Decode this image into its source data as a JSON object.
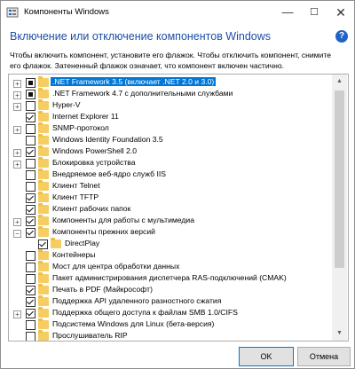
{
  "window": {
    "title": "Компоненты Windows",
    "controls": {
      "minimize": "—",
      "maximize": "☐",
      "close": "✕"
    }
  },
  "heading": "Включение или отключение компонентов Windows",
  "help_icon": "?",
  "description": [
    "Чтобы включить компонент, установите его флажок. Чтобы отключить компонент, снимите",
    "его флажок. Затененный флажок означает, что компонент включен частично."
  ],
  "features": [
    {
      "label": ".NET Framework 3.5 (включает .NET 2.0 и 3.0)",
      "state": "partial",
      "expandable": true,
      "selected": true,
      "level": 0
    },
    {
      "label": ".NET Framework 4.7 с дополнительными службами",
      "state": "partial",
      "expandable": true,
      "selected": false,
      "level": 0
    },
    {
      "label": "Hyper-V",
      "state": "unchecked",
      "expandable": true,
      "selected": false,
      "level": 0
    },
    {
      "label": "Internet Explorer 11",
      "state": "checked",
      "expandable": false,
      "selected": false,
      "level": 0
    },
    {
      "label": "SNMP-протокол",
      "state": "unchecked",
      "expandable": true,
      "selected": false,
      "level": 0
    },
    {
      "label": "Windows Identity Foundation 3.5",
      "state": "unchecked",
      "expandable": false,
      "selected": false,
      "level": 0
    },
    {
      "label": "Windows PowerShell 2.0",
      "state": "checked",
      "expandable": true,
      "selected": false,
      "level": 0
    },
    {
      "label": "Блокировка устройства",
      "state": "unchecked",
      "expandable": true,
      "selected": false,
      "level": 0
    },
    {
      "label": "Внедряемое веб-ядро служб IIS",
      "state": "unchecked",
      "expandable": false,
      "selected": false,
      "level": 0
    },
    {
      "label": "Клиент Telnet",
      "state": "unchecked",
      "expandable": false,
      "selected": false,
      "level": 0
    },
    {
      "label": "Клиент TFTP",
      "state": "checked",
      "expandable": false,
      "selected": false,
      "level": 0
    },
    {
      "label": "Клиент рабочих папок",
      "state": "checked",
      "expandable": false,
      "selected": false,
      "level": 0
    },
    {
      "label": "Компоненты для работы с мультимедиа",
      "state": "checked",
      "expandable": true,
      "selected": false,
      "level": 0
    },
    {
      "label": "Компоненты прежних версий",
      "state": "checked",
      "expandable": true,
      "expanded": true,
      "selected": false,
      "level": 0
    },
    {
      "label": "DirectPlay",
      "state": "checked",
      "expandable": false,
      "selected": false,
      "level": 1
    },
    {
      "label": "Контейнеры",
      "state": "unchecked",
      "expandable": false,
      "selected": false,
      "level": 0
    },
    {
      "label": "Мост для центра обработки данных",
      "state": "unchecked",
      "expandable": false,
      "selected": false,
      "level": 0
    },
    {
      "label": "Пакет администрирования диспетчера RAS-подключений (CMAK)",
      "state": "unchecked",
      "expandable": false,
      "selected": false,
      "level": 0
    },
    {
      "label": "Печать в PDF (Майкрософт)",
      "state": "checked",
      "expandable": false,
      "selected": false,
      "level": 0
    },
    {
      "label": "Поддержка API удаленного разностного сжатия",
      "state": "checked",
      "expandable": false,
      "selected": false,
      "level": 0
    },
    {
      "label": "Поддержка общего доступа к файлам SMB 1.0/CIFS",
      "state": "checked",
      "expandable": true,
      "selected": false,
      "level": 0
    },
    {
      "label": "Подсистема Windows для Linux (бета-версия)",
      "state": "unchecked",
      "expandable": false,
      "selected": false,
      "level": 0
    },
    {
      "label": "Прослушиватель RIP",
      "state": "unchecked",
      "expandable": false,
      "selected": false,
      "level": 0
    }
  ],
  "buttons": {
    "ok": "OK",
    "cancel": "Отмена"
  },
  "colors": {
    "heading": "#1d4ea8",
    "selection": "#0078d7",
    "folder": "#f5cd62",
    "help": "#1f63c7"
  }
}
